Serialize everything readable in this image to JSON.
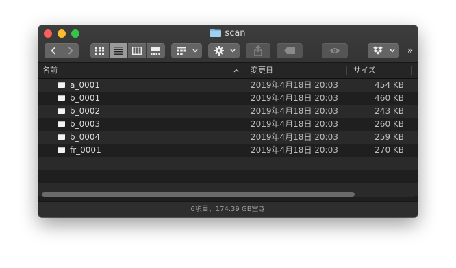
{
  "window": {
    "title": "scan"
  },
  "toolbar": {
    "overflow_label": "»",
    "icons": [
      "back-icon",
      "forward-icon",
      "grid-view-icon",
      "list-view-icon",
      "column-view-icon",
      "gallery-view-icon",
      "group-icon",
      "gear-icon",
      "share-icon",
      "tag-icon",
      "quicklook-icon",
      "dropbox-icon"
    ]
  },
  "columns": {
    "name": "名前",
    "date": "変更日",
    "size": "サイズ"
  },
  "files": [
    {
      "name": "a_0001",
      "date": "2019年4月18日 20:03",
      "size": "454 KB"
    },
    {
      "name": "b_0001",
      "date": "2019年4月18日 20:03",
      "size": "460 KB"
    },
    {
      "name": "b_0002",
      "date": "2019年4月18日 20:03",
      "size": "243 KB"
    },
    {
      "name": "b_0003",
      "date": "2019年4月18日 20:03",
      "size": "260 KB"
    },
    {
      "name": "b_0004",
      "date": "2019年4月18日 20:03",
      "size": "259 KB"
    },
    {
      "name": "fr_0001",
      "date": "2019年4月18日 20:03",
      "size": "270 KB"
    }
  ],
  "status": {
    "text": "6項目、174.39 GB空き"
  }
}
